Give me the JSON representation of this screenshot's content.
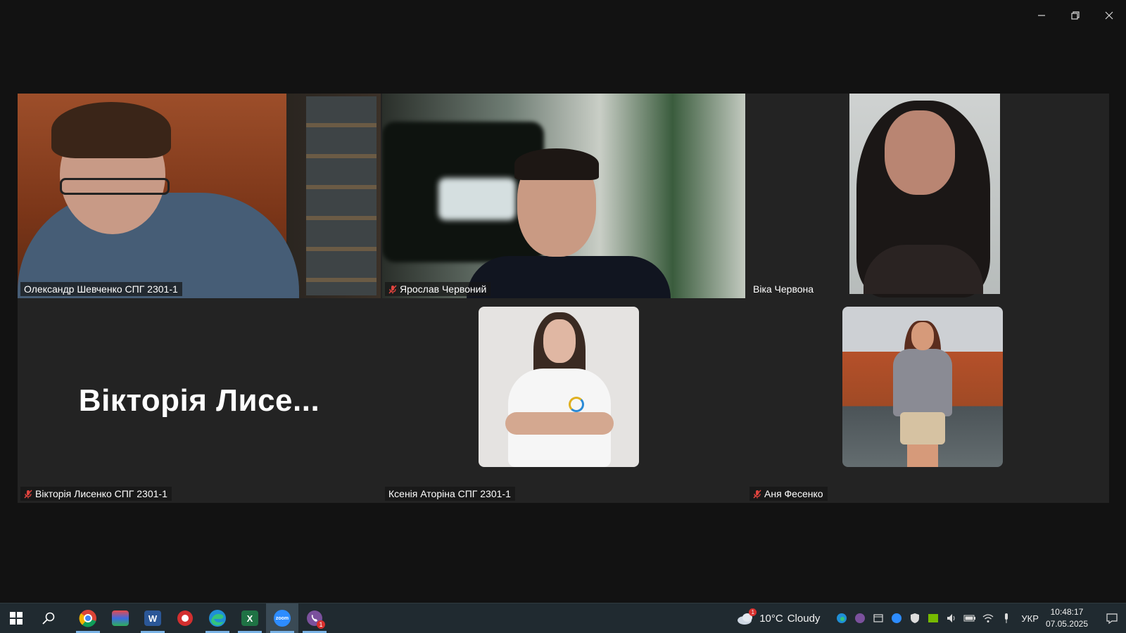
{
  "window": {
    "controls": {
      "minimize": "minimize",
      "restore": "restore",
      "close": "close"
    }
  },
  "participants": [
    {
      "name": "Олександр Шевченко СПГ 2301-1",
      "muted": false,
      "active_speaker": true
    },
    {
      "name": "Ярослав Червоний",
      "muted": true,
      "active_speaker": false
    },
    {
      "name": "Віка Червона",
      "muted": false,
      "active_speaker": false
    },
    {
      "name": "Вікторія Лисенко СПГ 2301-1",
      "avatar_text": "Вікторія Лисе...",
      "muted": true,
      "active_speaker": false
    },
    {
      "name": "Ксенія Аторіна СПГ 2301-1",
      "muted": false,
      "active_speaker": false
    },
    {
      "name": "Аня Фесенко",
      "muted": true,
      "active_speaker": false
    }
  ],
  "taskbar": {
    "apps": [
      {
        "name": "start",
        "icon": "windows-logo-icon"
      },
      {
        "name": "search",
        "icon": "search-icon"
      },
      {
        "name": "chrome",
        "icon": "chrome-icon",
        "running": true
      },
      {
        "name": "app",
        "icon": "app-tile-icon"
      },
      {
        "name": "word",
        "icon": "word-icon",
        "running": true,
        "letter": "W"
      },
      {
        "name": "app",
        "icon": "red-app-icon"
      },
      {
        "name": "edge",
        "icon": "edge-icon",
        "running": true
      },
      {
        "name": "excel",
        "icon": "excel-icon",
        "running": true,
        "letter": "X"
      },
      {
        "name": "zoom",
        "icon": "zoom-icon",
        "running": true,
        "active": true,
        "letter": "zoom"
      },
      {
        "name": "viber",
        "icon": "viber-icon",
        "running": true,
        "badge": "1"
      }
    ],
    "weather": {
      "temp": "10°C",
      "condition": "Cloudy",
      "badge": "1"
    },
    "language": "УКР",
    "time": "10:48:17",
    "date": "07.05.2025"
  },
  "colors": {
    "active_speaker_border": "#23d96a",
    "mute_icon": "#e0443e",
    "taskbar_bg": "#202a30",
    "gallery_bg": "#232323"
  }
}
